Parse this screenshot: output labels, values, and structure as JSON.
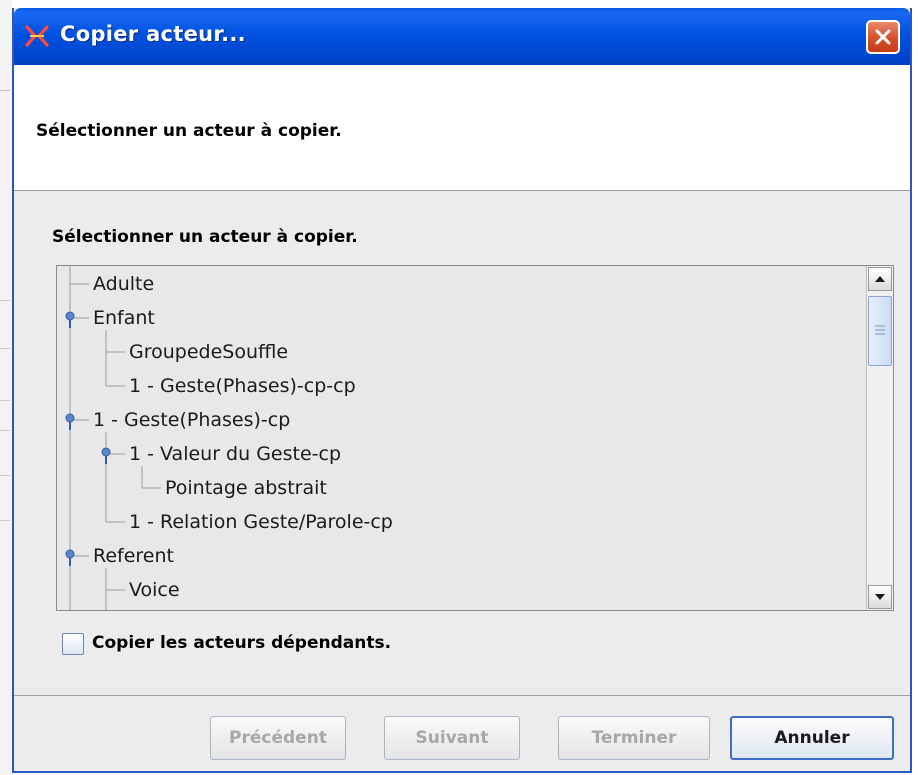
{
  "window": {
    "title": "Copier acteur...",
    "icon": "xwing-app-icon",
    "close_icon": "close-icon"
  },
  "header": {
    "text": "Sélectionner un acteur à copier."
  },
  "content": {
    "label": "Sélectionner un acteur à copier.",
    "tree_items": [
      {
        "label": "Adulte",
        "level": 0,
        "has_toggle": false
      },
      {
        "label": "Enfant",
        "level": 0,
        "has_toggle": true
      },
      {
        "label": "GroupedeSouffle",
        "level": 1,
        "has_toggle": false
      },
      {
        "label": "1 - Geste(Phases)-cp-cp",
        "level": 1,
        "has_toggle": false
      },
      {
        "label": "1 - Geste(Phases)-cp",
        "level": 0,
        "has_toggle": true
      },
      {
        "label": "1 - Valeur du Geste-cp",
        "level": 1,
        "has_toggle": true
      },
      {
        "label": "Pointage abstrait",
        "level": 2,
        "has_toggle": false
      },
      {
        "label": "1 - Relation Geste/Parole-cp",
        "level": 1,
        "has_toggle": false
      },
      {
        "label": "Referent",
        "level": 0,
        "has_toggle": true
      },
      {
        "label": "Voice",
        "level": 1,
        "has_toggle": false
      }
    ],
    "checkbox": {
      "label": "Copier les acteurs dépendants.",
      "checked": false
    }
  },
  "footer": {
    "buttons": [
      {
        "label": "Précédent",
        "enabled": false
      },
      {
        "label": "Suivant",
        "enabled": false
      },
      {
        "label": "Terminer",
        "enabled": false
      },
      {
        "label": "Annuler",
        "enabled": true
      }
    ]
  },
  "colors": {
    "titlebar": "#0052e0",
    "close_button": "#d7532f",
    "focus_border": "#3c6fc4",
    "disabled_text": "#a7a7a7"
  }
}
